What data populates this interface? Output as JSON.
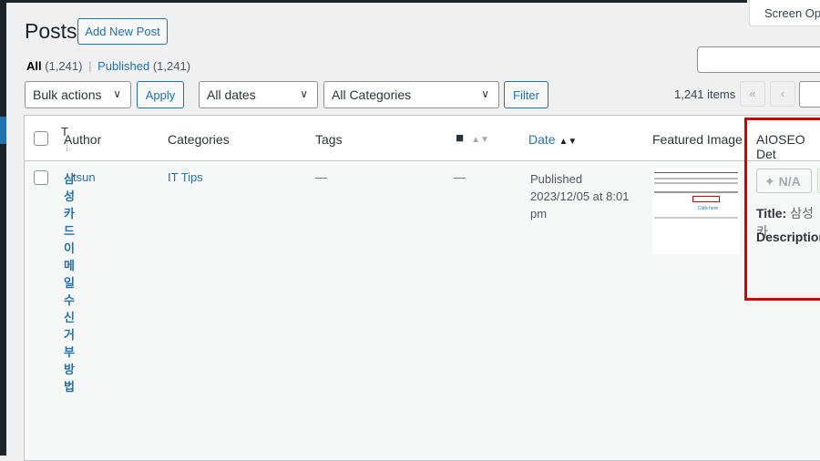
{
  "header": {
    "title": "Posts",
    "add_new": "Add New Post",
    "screen_options": "Screen Opt"
  },
  "filters": {
    "all_label": "All",
    "all_count": "(1,241)",
    "sep": "|",
    "published_label": "Published",
    "published_count": "(1,241)"
  },
  "toolbar": {
    "bulk_actions": "Bulk actions",
    "apply": "Apply",
    "dates": "All dates",
    "categories": "All Categories",
    "filter": "Filter",
    "items": "1,241 items",
    "first": "«",
    "prev": "‹"
  },
  "columns": {
    "title": "T",
    "author": "Author",
    "categories": "Categories",
    "tags": "Tags",
    "date": "Date",
    "featured": "Featured Image",
    "aioseo": "AIOSEO Det"
  },
  "rows": [
    {
      "title": "삼성카드이메일수신거부방법",
      "author": "tsun",
      "category": "IT Tips",
      "tags": "—",
      "comments": "—",
      "status": "Published",
      "date": "2023/12/05 at 8:01",
      "time": "pm",
      "aioseo_score": "N/A",
      "aioseo_title_label": "Title:",
      "aioseo_title": "삼성카",
      "aioseo_desc_label": "Description",
      "thumb_link": "Click here"
    }
  ],
  "colors": {
    "accent": "#2271b1",
    "highlight": "#d50000"
  }
}
